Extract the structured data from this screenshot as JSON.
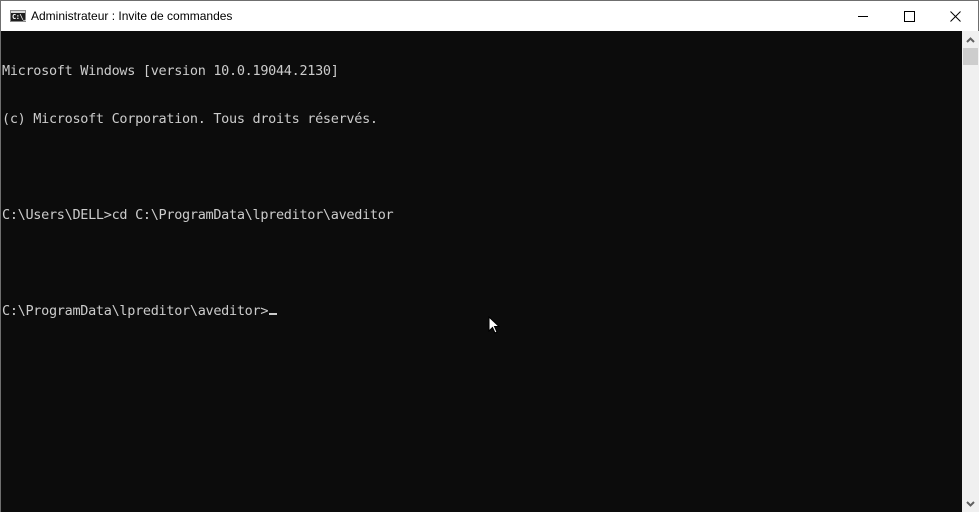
{
  "window": {
    "title": "Administrateur : Invite de commandes",
    "app_icon_glyph": "C:\\_",
    "controls": {
      "minimize": "minimize",
      "maximize": "maximize",
      "close": "close"
    }
  },
  "console": {
    "lines": [
      "Microsoft Windows [version 10.0.19044.2130]",
      "(c) Microsoft Corporation. Tous droits réservés.",
      "",
      "C:\\Users\\DELL>cd C:\\ProgramData\\lpreditor\\aveditor",
      "",
      "C:\\ProgramData\\lpreditor\\aveditor>"
    ],
    "text_color": "#cccccc",
    "background_color": "#0c0c0c"
  },
  "scrollbar": {
    "position_fraction": 0
  }
}
